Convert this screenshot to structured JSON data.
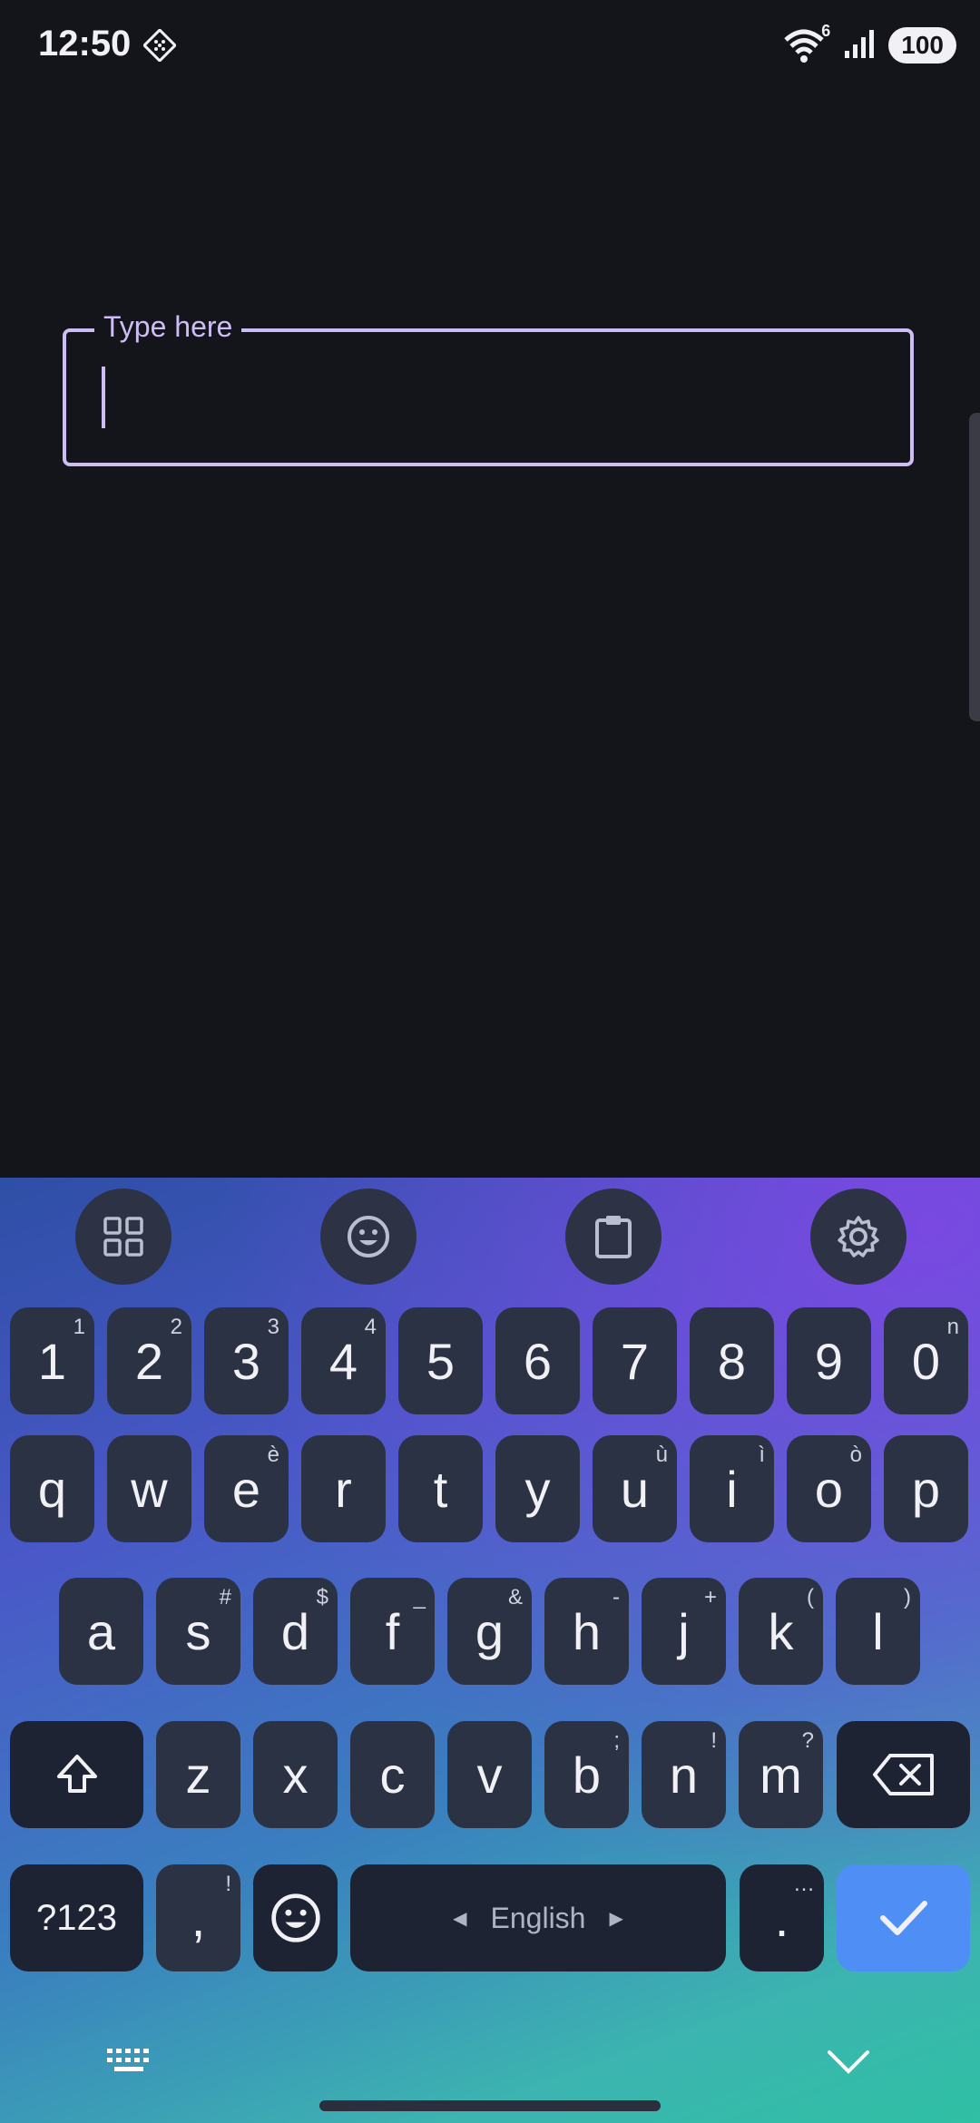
{
  "status_bar": {
    "time": "12:50",
    "battery": "100",
    "wifi_badge": "6"
  },
  "text_field": {
    "label": "Type here",
    "value": ""
  },
  "toolbar": [
    "grid-icon",
    "emoji-icon",
    "clipboard-icon",
    "settings-icon"
  ],
  "rows": {
    "numbers": [
      {
        "k": "1",
        "s": "1"
      },
      {
        "k": "2",
        "s": "2"
      },
      {
        "k": "3",
        "s": "3"
      },
      {
        "k": "4",
        "s": "4"
      },
      {
        "k": "5",
        "s": ""
      },
      {
        "k": "6",
        "s": ""
      },
      {
        "k": "7",
        "s": ""
      },
      {
        "k": "8",
        "s": ""
      },
      {
        "k": "9",
        "s": ""
      },
      {
        "k": "0",
        "s": "n"
      }
    ],
    "top": [
      {
        "k": "q",
        "s": ""
      },
      {
        "k": "w",
        "s": ""
      },
      {
        "k": "e",
        "s": "è"
      },
      {
        "k": "r",
        "s": ""
      },
      {
        "k": "t",
        "s": ""
      },
      {
        "k": "y",
        "s": ""
      },
      {
        "k": "u",
        "s": "ù"
      },
      {
        "k": "i",
        "s": "ì"
      },
      {
        "k": "o",
        "s": "ò"
      },
      {
        "k": "p",
        "s": ""
      }
    ],
    "middle": [
      {
        "k": "a",
        "s": ""
      },
      {
        "k": "s",
        "s": "#"
      },
      {
        "k": "d",
        "s": "$"
      },
      {
        "k": "f",
        "s": "_"
      },
      {
        "k": "g",
        "s": "&"
      },
      {
        "k": "h",
        "s": "-"
      },
      {
        "k": "j",
        "s": "+"
      },
      {
        "k": "k",
        "s": "("
      },
      {
        "k": "l",
        "s": ")"
      }
    ],
    "bottom": [
      {
        "k": "z",
        "s": ""
      },
      {
        "k": "x",
        "s": ""
      },
      {
        "k": "c",
        "s": ""
      },
      {
        "k": "v",
        "s": ""
      },
      {
        "k": "b",
        "s": ";"
      },
      {
        "k": "n",
        "s": "!"
      },
      {
        "k": "m",
        "s": "?"
      }
    ]
  },
  "function_row": {
    "symbols": "?123",
    "comma": ",",
    "comma_sup": "!",
    "space_label": "English",
    "period": ".",
    "period_sup": "…"
  }
}
